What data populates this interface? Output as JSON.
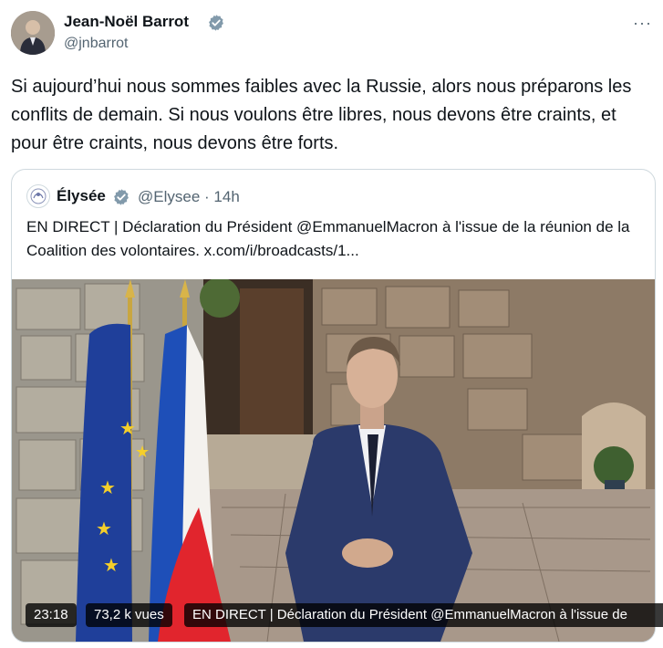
{
  "tweet": {
    "author_name": "Jean-Noël Barrot",
    "author_handle": "@jnbarrot",
    "more_label": "···",
    "text": "Si aujourd’hui nous sommes faibles avec la Russie, alors nous préparons les conflits de demain. Si nous voulons être libres, nous devons être craints, et pour être craints, nous devons être forts."
  },
  "quote": {
    "author_name": "Élysée",
    "author_handle": "@Elysee",
    "time": "· 14h",
    "text": "EN DIRECT | Déclaration du Président @EmmanuelMacron à l'issue de la réunion de la Coalition des volontaires. x.com/i/broadcasts/1..."
  },
  "media": {
    "duration": "23:18",
    "views": "73,2 k vues",
    "title": "EN DIRECT | Déclaration du Président @EmmanuelMacron à l'issue de"
  },
  "colors": {
    "verified": "#829aab",
    "handle": "#536471",
    "border": "#cfd9de",
    "eu_blue": "#1f3f9a",
    "fr_blue": "#1e4fb8",
    "fr_red": "#e1252d",
    "suit": "#2b3a6b"
  },
  "icons": {
    "verified": "verified-badge-icon",
    "more": "more-icon",
    "elysee_logo": "elysee-logo-icon"
  }
}
